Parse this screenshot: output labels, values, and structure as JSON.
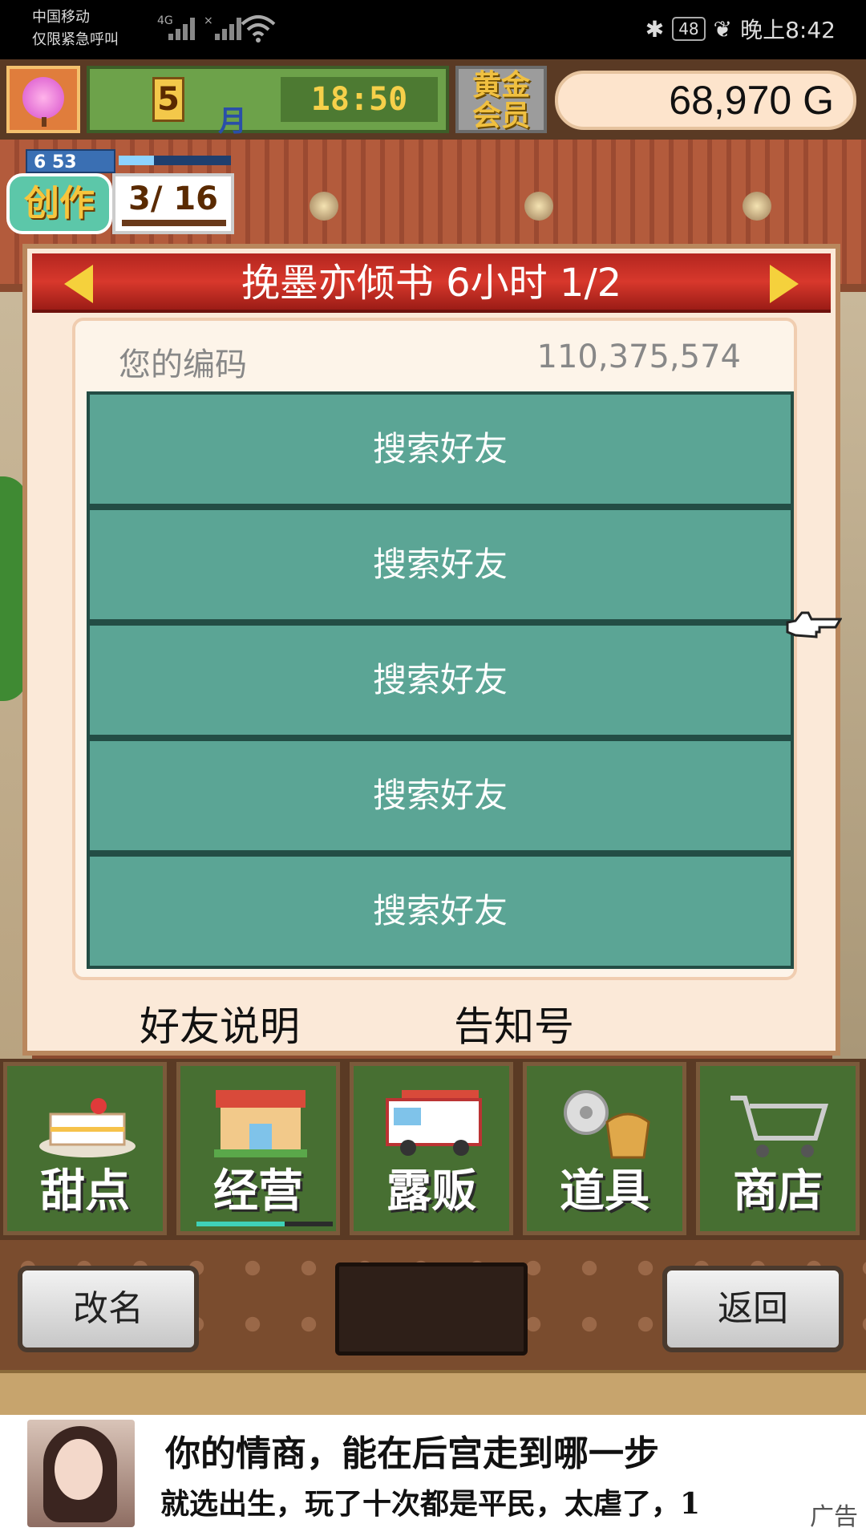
{
  "status_bar": {
    "carrier_line1": "中国移动",
    "carrier_line2": "仅限紧急呼叫",
    "network": "4G",
    "battery": "48",
    "time": "晚上8:42"
  },
  "hud": {
    "month_number": "5",
    "month_label": "月",
    "clock": "18:50",
    "membership": "黄金会员",
    "money": "68,970 G"
  },
  "create": {
    "level_text": "6  53",
    "tag": "创作",
    "count": "3/ 16"
  },
  "dialog": {
    "title": "挽墨亦倾书  6小时 1/2",
    "code_label": "您的编码",
    "code_value": "110,375,574",
    "slots": [
      "搜索好友",
      "搜索好友",
      "搜索好友",
      "搜索好友",
      "搜索好友"
    ],
    "footer_left": "好友说明",
    "footer_right": "告知号"
  },
  "menu": [
    "甜点",
    "经营",
    "露贩",
    "道具",
    "商店"
  ],
  "bottom_bar": {
    "rename": "改名",
    "back": "返回"
  },
  "ad": {
    "line1": "你的情商，能在后宫走到哪一步",
    "line2": "就选出生，玩了十次都是平民，太虐了，1",
    "tag": "广告"
  },
  "colors": {
    "slot": "#5ba595",
    "header": "#c42d24",
    "menu_bg": "#476f32",
    "panel": "#fbe9d8"
  }
}
